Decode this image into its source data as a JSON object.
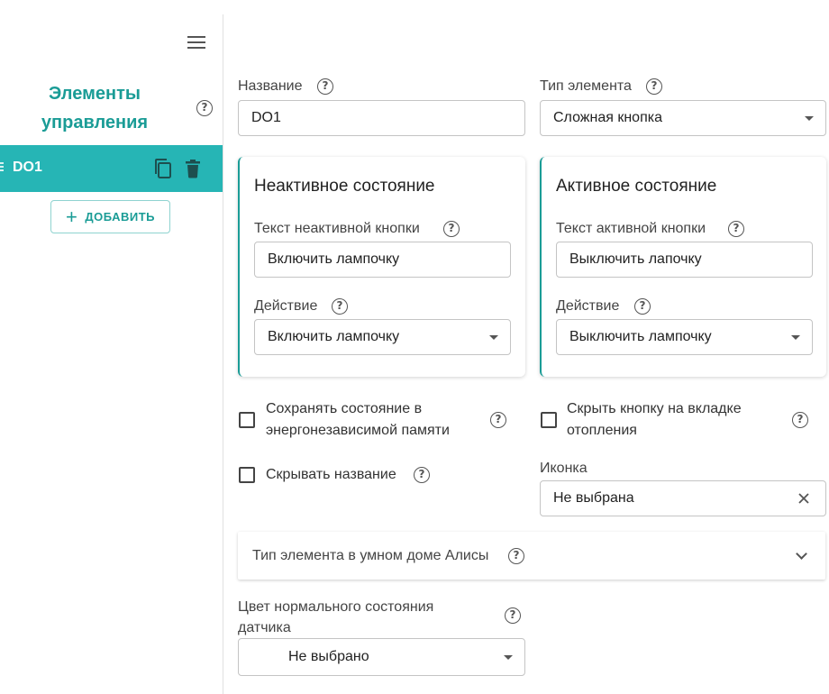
{
  "sidebar": {
    "title_line1": "Элементы",
    "title_line2": "управления",
    "help": "?",
    "items": [
      {
        "label": "DO1"
      }
    ],
    "add_button": {
      "icon": "+",
      "label": "ДОБАВИТЬ"
    }
  },
  "form": {
    "name": {
      "label": "Название",
      "value": "DO1"
    },
    "element_type": {
      "label": "Тип элемента",
      "value": "Сложная кнопка"
    },
    "inactive": {
      "title": "Неактивное состояние",
      "text_label": "Текст неактивной кнопки",
      "text_value": "Включить лампочку",
      "action_label": "Действие",
      "action_value": "Включить лампочку"
    },
    "active": {
      "title": "Активное состояние",
      "text_label": "Текст активной кнопки",
      "text_value": "Выключить лапочку",
      "action_label": "Действие",
      "action_value": "Выключить лампочку"
    },
    "save_state": {
      "line1": "Сохранять состояние в",
      "line2": "энергонезависимой памяти",
      "checked": false
    },
    "hide_heating": {
      "line1": "Скрыть кнопку на вкладке",
      "line2": "отопления",
      "checked": false
    },
    "hide_name": {
      "label": "Скрывать название",
      "checked": false
    },
    "icon": {
      "label": "Иконка",
      "value": "Не выбрана"
    },
    "alice_type": {
      "label": "Тип элемента в умном доме Алисы"
    },
    "normal_color": {
      "line1": "Цвет нормального состояния",
      "line2": "датчика",
      "value": "Не выбрано"
    }
  },
  "colors": {
    "accent": "#1a9c96",
    "sidebar_active": "#26b5b5"
  }
}
